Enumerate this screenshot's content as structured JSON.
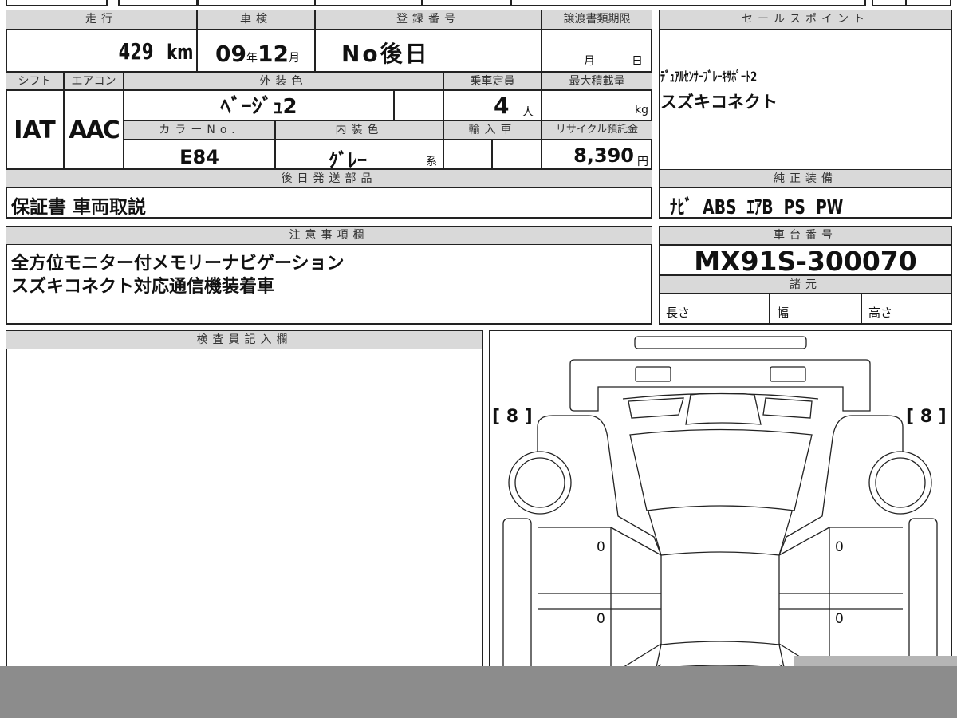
{
  "sheet": {
    "mileage": {
      "label": "走行",
      "value": "429",
      "unit": "km"
    },
    "inspection": {
      "label": "車検",
      "year": "09",
      "year_unit": "年",
      "month": "12",
      "month_unit": "月"
    },
    "registration": {
      "label": "登録番号",
      "value": "No後日"
    },
    "transfer_deadline": {
      "label": "譲渡書類期限",
      "month_unit": "月",
      "day_unit": "日"
    },
    "shift": {
      "label": "シフト",
      "value": "IAT"
    },
    "aircon": {
      "label": "エアコン",
      "value": "AAC"
    },
    "exterior_color": {
      "label": "外装色",
      "value": "ﾍﾞｰｼﾞｭ2"
    },
    "capacity": {
      "label": "乗車定員",
      "value": "4",
      "unit": "人"
    },
    "max_load": {
      "label": "最大積載量",
      "unit": "kg"
    },
    "color_no": {
      "label": "カラーNo.",
      "value": "E84"
    },
    "interior_color": {
      "label": "内装色",
      "value": "ｸﾞﾚｰ",
      "suffix": "系"
    },
    "import": {
      "label": "輸入車"
    },
    "recycle": {
      "label": "リサイクル預託金",
      "value": "8,390",
      "unit": "円"
    },
    "later_parts": {
      "label": "後日発送部品",
      "value": "保証書 車両取説"
    },
    "sales_points": {
      "label": "セールスポイント",
      "lines": [
        "ﾃﾞｭｱﾙｾﾝｻｰﾌﾞﾚｰｷｻﾎﾟｰﾄ2",
        "スズキコネクト"
      ]
    },
    "equipment": {
      "label": "純正装備",
      "value": "ﾅﾋﾞ  ABS  ｴｱB  PS  PW"
    },
    "notes": {
      "label": "注意事項欄",
      "lines": [
        "全方位モニター付メモリーナビゲーション",
        "スズキコネクト対応通信機装着車"
      ]
    },
    "chassis": {
      "label": "車台番号",
      "value": "MX91S-300070"
    },
    "specs": {
      "label": "諸元",
      "length": "長さ",
      "width": "幅",
      "height": "高さ"
    },
    "inspector": {
      "label": "検査員記入欄"
    },
    "diagram": {
      "left_mark": "[ 8 ]",
      "right_mark": "[ 8 ]",
      "door_marks": [
        "0",
        "0",
        "0",
        "0"
      ]
    }
  }
}
